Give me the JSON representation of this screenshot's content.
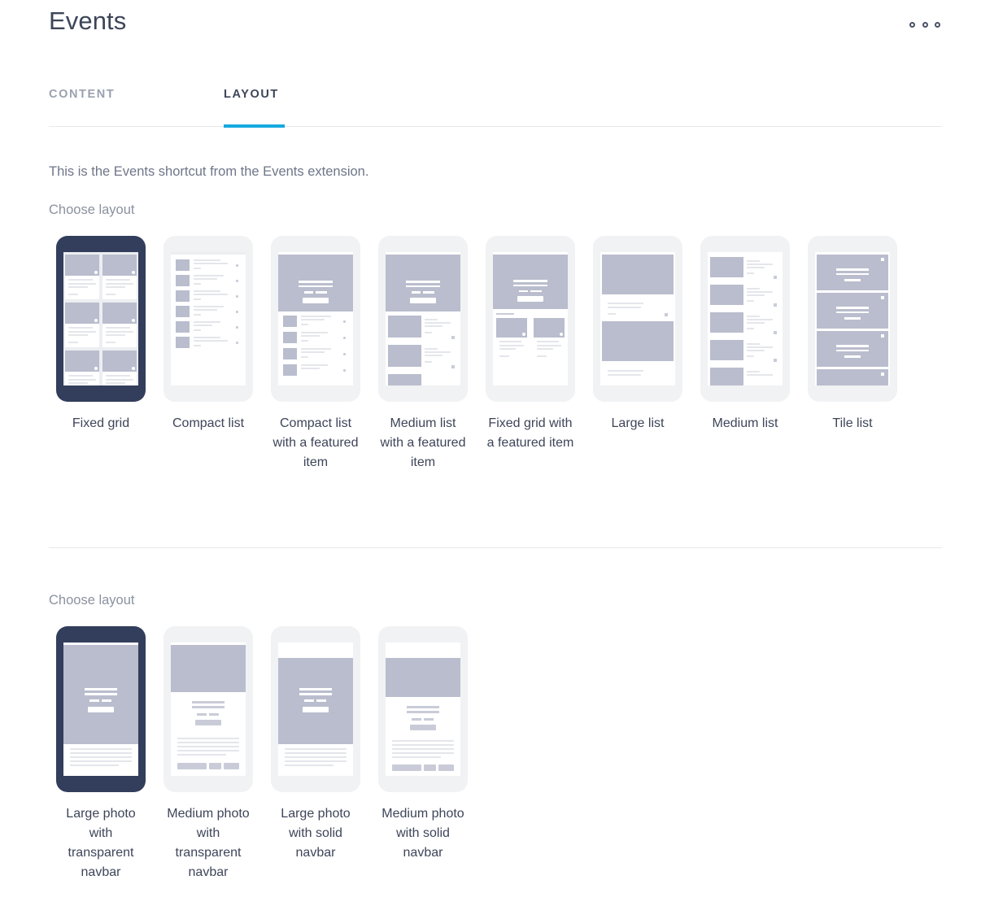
{
  "header": {
    "title": "Events",
    "overflow_label": "More options"
  },
  "tabs": [
    {
      "label": "CONTENT",
      "active": false
    },
    {
      "label": "LAYOUT",
      "active": true
    }
  ],
  "accent_color": "#16a9e0",
  "selected_color": "#333d5c",
  "body": {
    "description": "This is the Events shortcut from the Events extension.",
    "choose_layout_label_1": "Choose layout",
    "choose_layout_label_2": "Choose layout"
  },
  "list_layouts": [
    {
      "label": "Fixed grid",
      "selected": true
    },
    {
      "label": "Compact list",
      "selected": false
    },
    {
      "label": "Compact list with a featured item",
      "selected": false
    },
    {
      "label": "Medium list with a featured item",
      "selected": false
    },
    {
      "label": "Fixed grid with a featured item",
      "selected": false
    },
    {
      "label": "Large list",
      "selected": false
    },
    {
      "label": "Medium list",
      "selected": false
    },
    {
      "label": "Tile list",
      "selected": false
    }
  ],
  "detail_layouts": [
    {
      "label": "Large photo with transparent navbar",
      "selected": true
    },
    {
      "label": "Medium photo with transparent navbar",
      "selected": false
    },
    {
      "label": "Large photo with solid navbar",
      "selected": false
    },
    {
      "label": "Medium photo with solid navbar",
      "selected": false
    }
  ]
}
